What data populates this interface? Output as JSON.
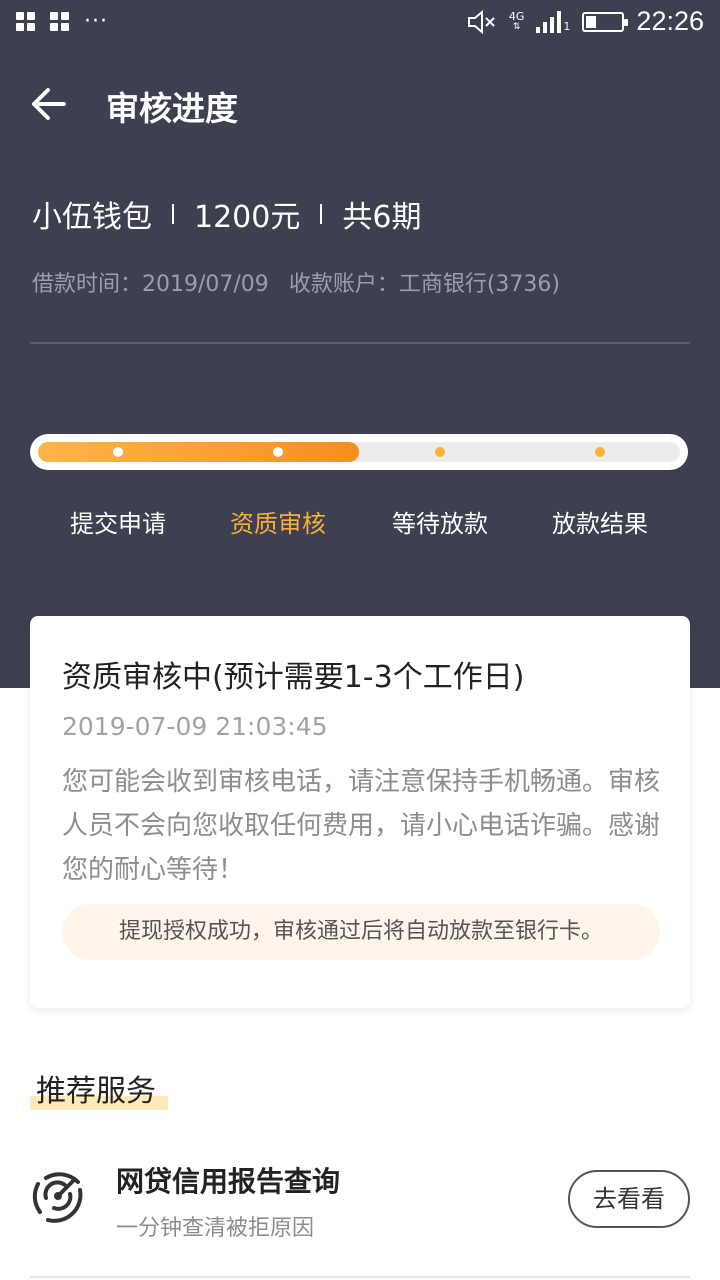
{
  "status_bar": {
    "time": "22:26",
    "network": "4G",
    "sim": "1"
  },
  "header": {
    "title": "审核进度"
  },
  "loan": {
    "product": "小伍钱包",
    "amount": "1200元",
    "terms": "共6期",
    "borrow_time": "借款时间：2019/07/09",
    "account": "收款账户：工商银行(3736)"
  },
  "progress": {
    "current_step_index": 1,
    "fill_fraction": 0.5,
    "steps": [
      {
        "label": "提交申请"
      },
      {
        "label": "资质审核"
      },
      {
        "label": "等待放款"
      },
      {
        "label": "放款结果"
      }
    ]
  },
  "status_card": {
    "title": "资质审核中(预计需要1-3个工作日)",
    "time": "2019-07-09 21:03:45",
    "description": "您可能会收到审核电话，请注意保持手机畅通。审核人员不会向您收取任何费用，请小心电话诈骗。感谢您的耐心等待！",
    "notice": "提现授权成功，审核通过后将自动放款至银行卡。"
  },
  "recommend": {
    "title": "推荐服务",
    "items": [
      {
        "name": "网贷信用报告查询",
        "subtitle": "一分钟查清被拒原因",
        "button_label": "去看看",
        "icon": "radar-icon"
      }
    ]
  },
  "colors": {
    "header_bg": "#3d4050",
    "accent": "#f9b135",
    "progress_start": "#ffb549",
    "progress_end": "#f78e20"
  }
}
